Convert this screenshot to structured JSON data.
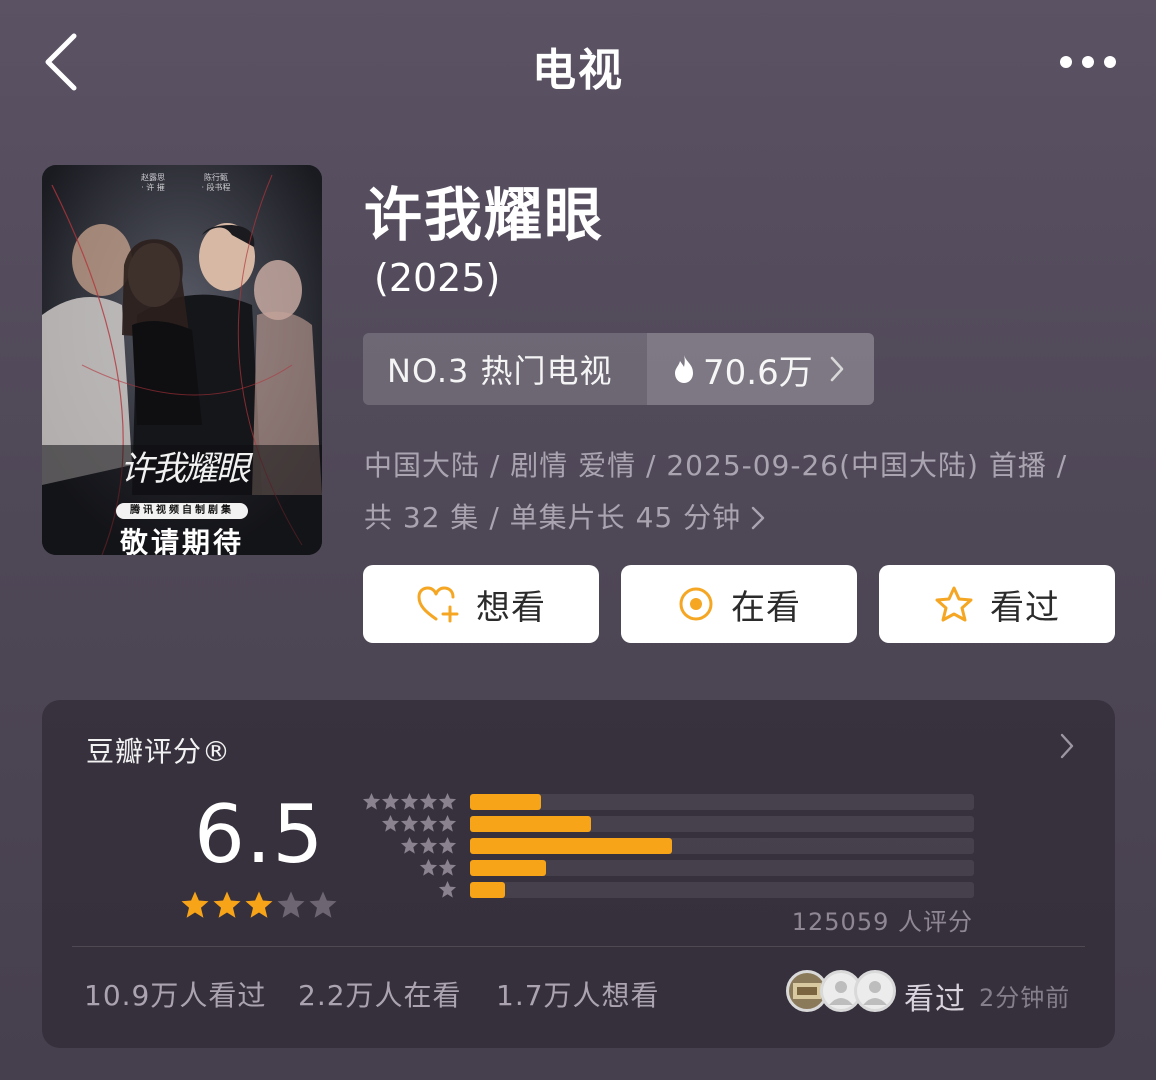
{
  "nav": {
    "title": "电视"
  },
  "poster": {
    "credit_left": "赵露思",
    "credit_left_sub": "· 许 摧",
    "credit_right": "陈行甄",
    "credit_right_sub": "· 段书程",
    "title_art": "许我耀眼",
    "badge": "腾讯视频自制剧集",
    "tagline": "敬请期待"
  },
  "show": {
    "title": "许我耀眼",
    "year": "(2025)",
    "rank_label": "NO.3 热门电视",
    "heat": "70.6万",
    "meta_line1": "中国大陆 / 剧情 爱情 / 2025-09-26(中国大陆) 首播 /",
    "meta_line2": "共 32 集 / 单集片长 45 分钟"
  },
  "actions": [
    {
      "label": "想看",
      "icon": "heart-plus-icon"
    },
    {
      "label": "在看",
      "icon": "target-circle-icon"
    },
    {
      "label": "看过",
      "icon": "star-outline-icon"
    }
  ],
  "rating": {
    "label": "豆瓣评分®",
    "score": "6.5",
    "stars_filled": 3,
    "stars_total": 5,
    "distribution": [
      {
        "stars": 5,
        "fraction": 0.14
      },
      {
        "stars": 4,
        "fraction": 0.24
      },
      {
        "stars": 3,
        "fraction": 0.4
      },
      {
        "stars": 2,
        "fraction": 0.15
      },
      {
        "stars": 1,
        "fraction": 0.07
      }
    ],
    "count": "125059 人评分",
    "accent_color": "#f7a419"
  },
  "stats": {
    "watched": "10.9万人看过",
    "watching": "2.2万人在看",
    "want": "1.7万人想看",
    "friend_label": "看过",
    "friend_time": "2分钟前"
  }
}
